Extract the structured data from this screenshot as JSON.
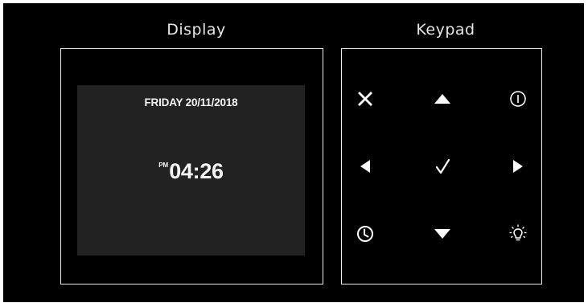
{
  "labels": {
    "display": "Display",
    "keypad": "Keypad"
  },
  "display": {
    "date": "FRIDAY 20/11/2018",
    "ampm": "PM",
    "time": "04:26"
  },
  "keypad": {
    "keys": [
      {
        "name": "cancel",
        "icon": "close-icon"
      },
      {
        "name": "up",
        "icon": "arrow-up-icon"
      },
      {
        "name": "power",
        "icon": "power-icon"
      },
      {
        "name": "left",
        "icon": "arrow-left-icon"
      },
      {
        "name": "confirm",
        "icon": "checkmark-icon"
      },
      {
        "name": "right",
        "icon": "arrow-right-icon"
      },
      {
        "name": "clock",
        "icon": "clock-icon"
      },
      {
        "name": "down",
        "icon": "arrow-down-icon"
      },
      {
        "name": "light",
        "icon": "lightbulb-icon"
      }
    ]
  },
  "colors": {
    "background": "#000000",
    "screen": "#222222",
    "foreground": "#f5f5f5"
  }
}
